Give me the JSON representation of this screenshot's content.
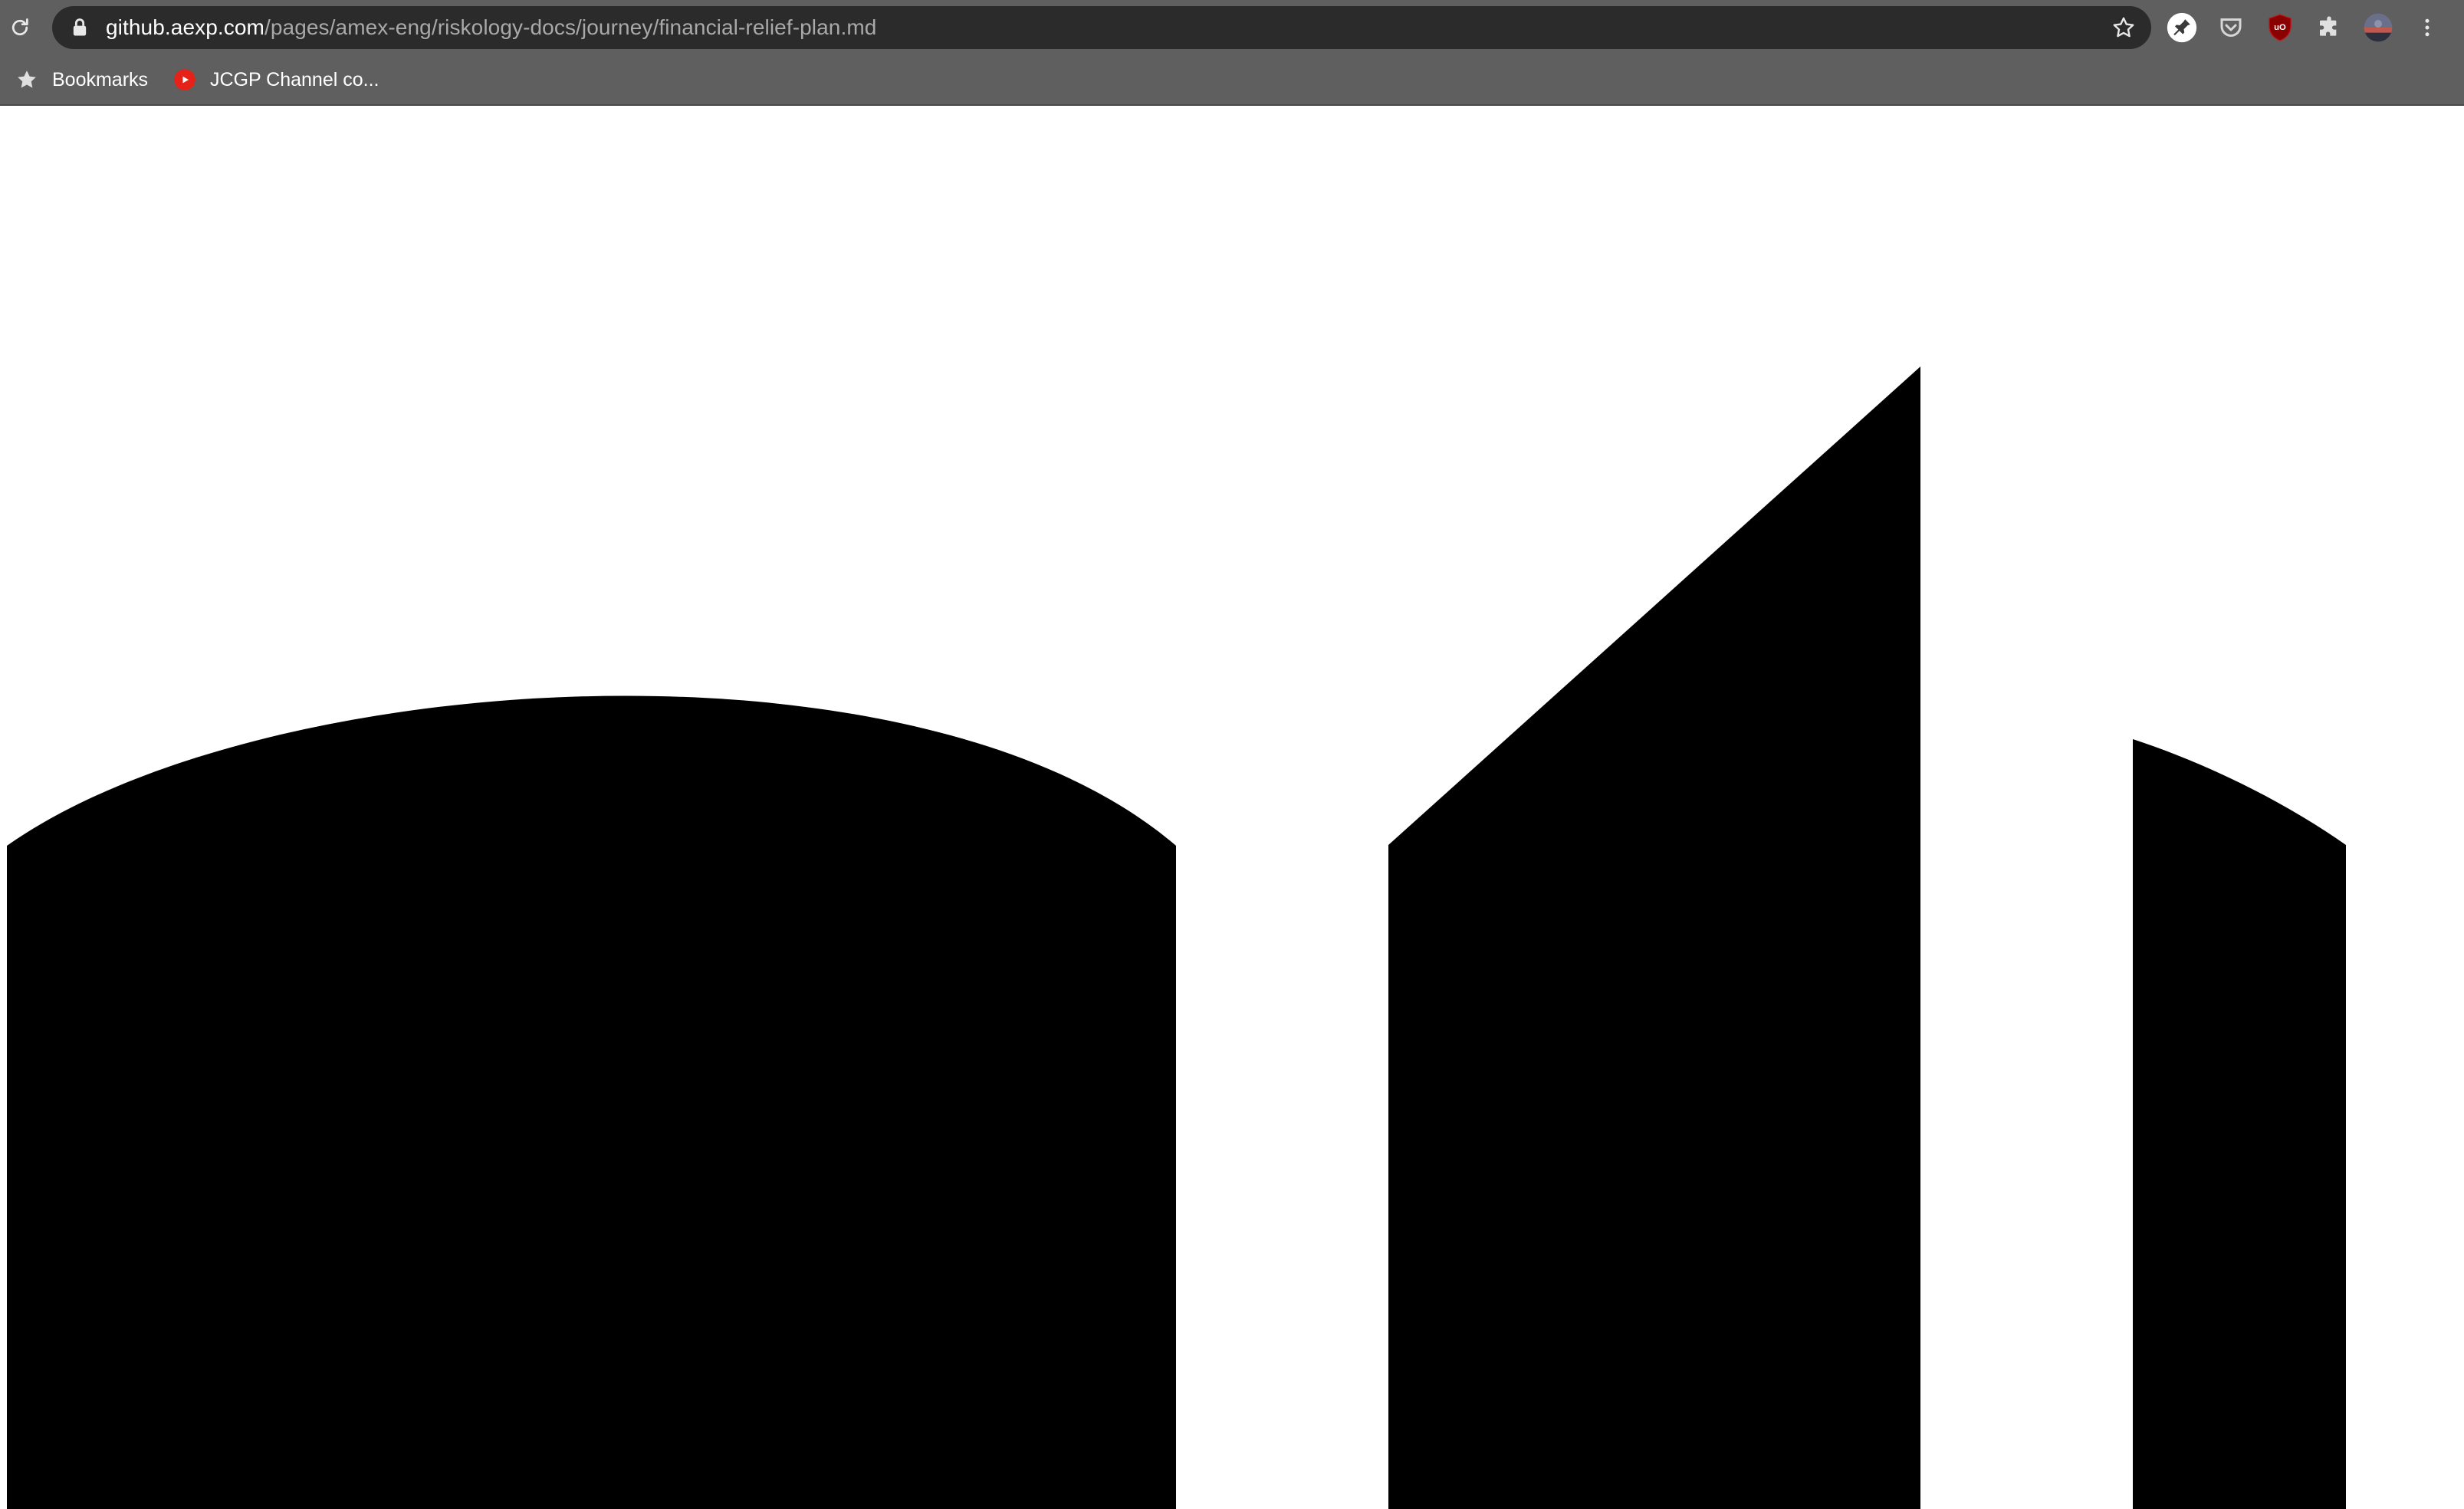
{
  "browser": {
    "url_host": "github.aexp.com",
    "url_path": "/pages/amex-eng/riskology-docs/journey/financial-relief-plan.md",
    "toolbar_icons": [
      "reload-icon",
      "lock-icon",
      "star-icon",
      "pin-extension-icon",
      "pocket-icon",
      "ublock-icon",
      "puzzle-extensions-icon",
      "profile-avatar",
      "kebab-menu-icon"
    ],
    "bookmarks": [
      {
        "label": "Bookmarks",
        "icon": "star-icon"
      },
      {
        "label": "JCGP Channel co...",
        "icon": "youtube-icon"
      }
    ]
  },
  "page": {
    "background": "#ffffff",
    "shape_fill": "#000000",
    "shapes": [
      "dome-shape",
      "slanted-tower-shape",
      "partial-dome-shape"
    ]
  },
  "colors": {
    "chrome_bg": "#5f5f5f",
    "omnibox_bg": "#2b2b2b",
    "url_host": "#ffffff",
    "url_path": "#a9a9a9",
    "youtube_red": "#e62117",
    "ublock_red": "#8b0000"
  }
}
